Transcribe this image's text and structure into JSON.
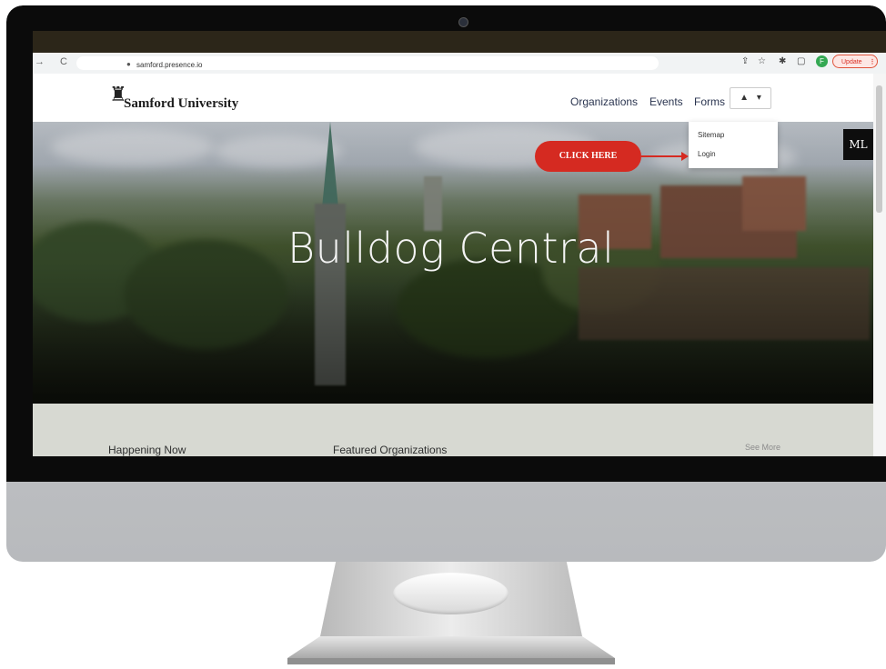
{
  "browser": {
    "url": "samford.presence.io",
    "update_label": "Update",
    "profile_initial": "F"
  },
  "site": {
    "logo_text": "Samford University",
    "nav": {
      "organizations": "Organizations",
      "events": "Events",
      "forms": "Forms"
    },
    "user_menu": {
      "items": [
        "Sitemap",
        "Login"
      ]
    }
  },
  "hero": {
    "title": "Bulldog Central",
    "badge": "ML"
  },
  "callout": {
    "label": "CLICK HERE",
    "color": "#d52a21"
  },
  "sections": {
    "happening_now": "Happening Now",
    "featured": "Featured Organizations",
    "see_more": "See More"
  },
  "icons": {
    "back": "back-arrow-icon",
    "reload": "reload-icon",
    "lock": "lock-icon",
    "share": "share-icon",
    "star": "star-icon",
    "extensions": "puzzle-icon",
    "sidepanel": "sidepanel-icon",
    "user": "user-icon",
    "caret": "caret-down-icon",
    "logo": "samford-logo-icon"
  }
}
